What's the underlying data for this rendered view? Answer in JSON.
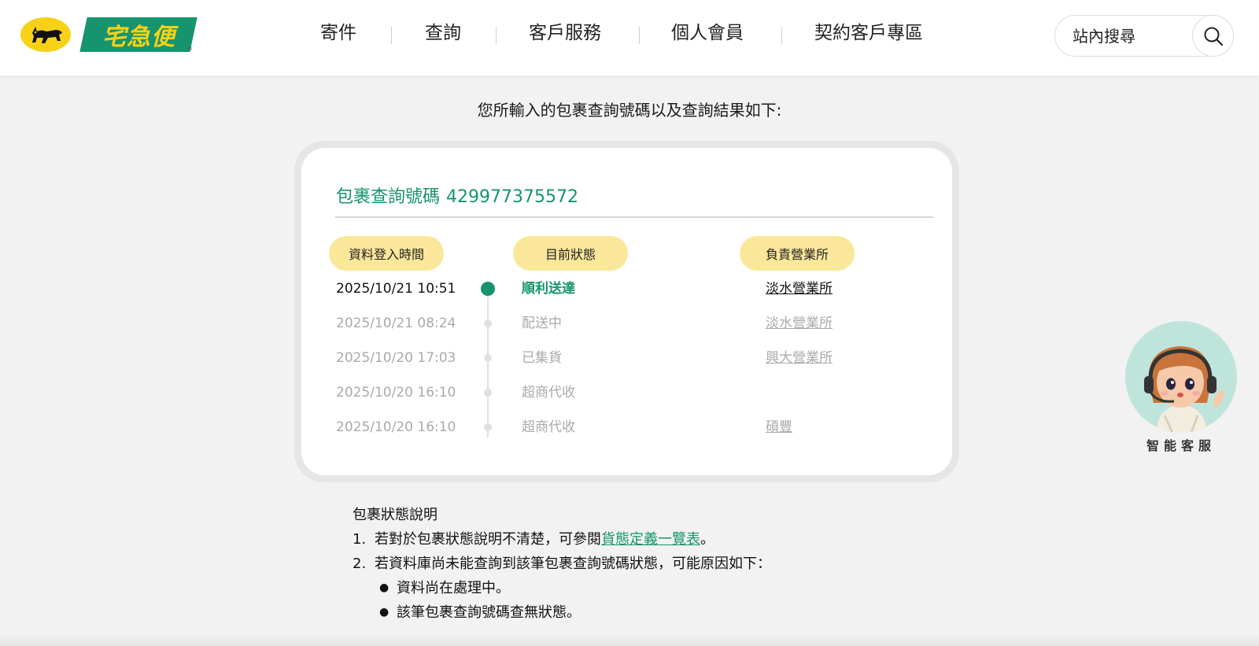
{
  "header": {
    "logo_text": "宅急便",
    "nav": [
      {
        "label": "寄件"
      },
      {
        "label": "查詢"
      },
      {
        "label": "客戶服務"
      },
      {
        "label": "個人會員"
      },
      {
        "label": "契約客戶專區"
      }
    ],
    "search": {
      "placeholder": "站內搜尋",
      "icon": "search-icon"
    }
  },
  "intro": "您所輸入的包裹查詢號碼以及查詢結果如下:",
  "tracking": {
    "title_label": "包裹查詢號碼",
    "number": "429977375572",
    "headers": {
      "time": "資料登入時間",
      "status": "目前狀態",
      "office": "負責營業所"
    },
    "rows": [
      {
        "time": "2025/10/21 10:51",
        "status": "順利送達",
        "office": "淡水營業所",
        "active": true
      },
      {
        "time": "2025/10/21 08:24",
        "status": "配送中",
        "office": "淡水營業所",
        "active": false
      },
      {
        "time": "2025/10/20 17:03",
        "status": "已集貨",
        "office": "興大營業所",
        "active": false
      },
      {
        "time": "2025/10/20 16:10",
        "status": "超商代收",
        "office": "",
        "active": false
      },
      {
        "time": "2025/10/20 16:10",
        "status": "超商代收",
        "office": "碩豐",
        "active": false
      }
    ],
    "accent_color": "#16946d",
    "pill_color": "#fbe79a"
  },
  "notes": {
    "title": "包裹狀態說明",
    "item1": {
      "num": "1.",
      "before": "若對於包裹狀態說明不清楚，可參閱",
      "link": "貨態定義一覽表",
      "after": "。"
    },
    "item2": {
      "num": "2.",
      "text": "若資料庫尚未能查詢到該筆包裹查詢號碼狀態，可能原因如下："
    },
    "bullets": [
      "資料尚在處理中。",
      "該筆包裹查詢號碼查無狀態。"
    ]
  },
  "assistant": {
    "label": "智能客服",
    "icon": "customer-service-avatar-icon"
  }
}
